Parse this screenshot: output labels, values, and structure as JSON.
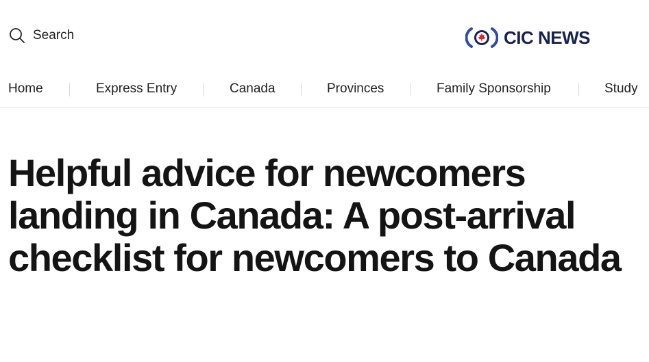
{
  "header": {
    "search_label": "Search",
    "search_icon": "search-icon",
    "logo_text": "CIC NEWS",
    "logo_icon": "maple-leaf-icon",
    "colors": {
      "logo_navy": "#16224f",
      "logo_blue": "#2f4ab0",
      "logo_red": "#e2232a"
    }
  },
  "nav": {
    "items": [
      {
        "label": "Home"
      },
      {
        "label": "Express Entry"
      },
      {
        "label": "Canada"
      },
      {
        "label": "Provinces"
      },
      {
        "label": "Family Sponsorship"
      },
      {
        "label": "Study"
      }
    ]
  },
  "article": {
    "title": "Helpful advice for newcomers landing in Canada: A post-arrival checklist for newcomers to Canada"
  }
}
